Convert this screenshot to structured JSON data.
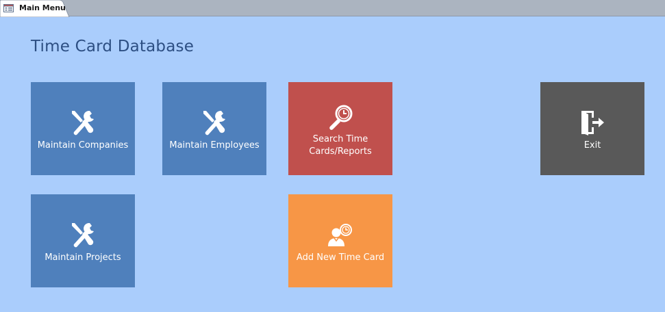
{
  "tab": {
    "label": "Main Menu",
    "icon": "form-icon"
  },
  "page": {
    "title": "Time Card Database"
  },
  "tiles": {
    "maintain_companies": {
      "label": "Maintain Companies",
      "icon": "tools-icon",
      "color": "#4f80bc"
    },
    "maintain_employees": {
      "label": "Maintain Employees",
      "icon": "tools-icon",
      "color": "#4f80bc"
    },
    "search_time_cards": {
      "label": "Search Time\nCards/Reports",
      "icon": "search-clock-icon",
      "color": "#c0504d"
    },
    "exit": {
      "label": "Exit",
      "icon": "exit-door-icon",
      "color": "#595959"
    },
    "maintain_projects": {
      "label": "Maintain Projects",
      "icon": "tools-icon",
      "color": "#4f80bc"
    },
    "add_new_time_card": {
      "label": "Add New Time Card",
      "icon": "user-clock-icon",
      "color": "#f79646"
    }
  },
  "colors": {
    "background": "#aacdfc",
    "title": "#2d4f83",
    "tabbar": "#abb4c0"
  }
}
